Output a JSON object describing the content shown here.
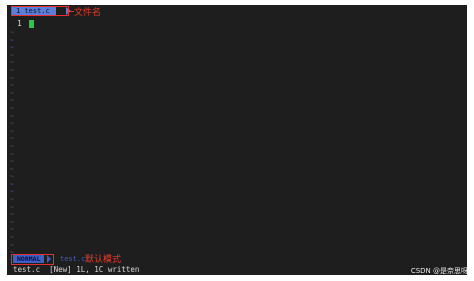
{
  "tabline": {
    "tab_label": "1  test.c",
    "annotation": "文件名"
  },
  "buffer": {
    "cursor_line_number": "1",
    "tilde_glyph": "~",
    "tilde_count": 30
  },
  "statusline": {
    "mode": "NORMAL",
    "filename": "test.c",
    "annotation": "默认模式"
  },
  "message_line": "test.c  [New] 1L, 1C written",
  "watermark": "CSDN @是奈思呀",
  "colors": {
    "background": "#1e1e1e",
    "tab_bg": "#5b7fd6",
    "mode_bg": "#3f5fc8",
    "cursor": "#27c93f",
    "annotation": "#e83a2a"
  }
}
